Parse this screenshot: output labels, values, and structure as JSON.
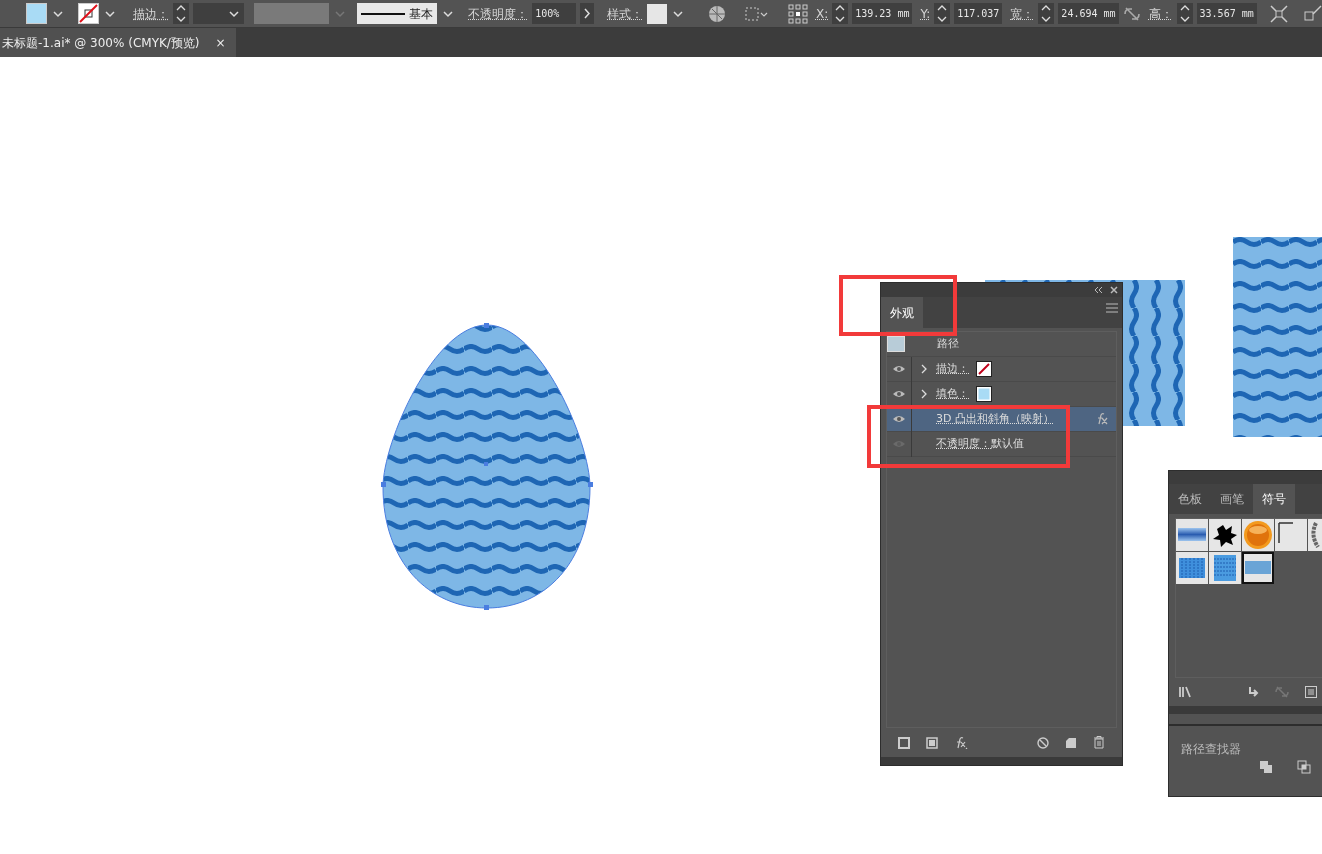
{
  "toolbar": {
    "stroke_label": "描边：",
    "brush_label": "基本",
    "opacity_label": "不透明度：",
    "opacity_value": "100%",
    "style_label": "样式：",
    "x_label": "X:",
    "x_value": "139.23 mm",
    "y_label": "Y:",
    "y_value": "117.037",
    "w_label": "宽：",
    "w_value": "24.694 mm",
    "h_label": "高：",
    "h_value": "33.567 mm"
  },
  "document_tab": {
    "title": "未标题-1.ai* @ 300% (CMYK/预览)",
    "close": "×"
  },
  "appearance_panel": {
    "tabs": [
      {
        "label": "外观",
        "selected": true
      }
    ],
    "items": [
      {
        "kind": "object",
        "label": "路径",
        "selected": false
      },
      {
        "kind": "stroke",
        "label": "描边：",
        "visible": true,
        "expandable": true,
        "selected": false
      },
      {
        "kind": "fill",
        "label": "填色：",
        "visible": true,
        "expandable": true,
        "selected": false
      },
      {
        "kind": "effect",
        "label": "3D 凸出和斜角（映射）",
        "visible": true,
        "expandable": false,
        "selected": true
      },
      {
        "kind": "opacity",
        "label": "不透明度：",
        "value": "默认值",
        "visible": false,
        "expandable": false,
        "selected": false
      }
    ]
  },
  "symbols_panel": {
    "tabs": [
      {
        "label": "色板",
        "selected": false
      },
      {
        "label": "画笔",
        "selected": false
      },
      {
        "label": "符号",
        "selected": true
      }
    ],
    "symbols": [
      {
        "kind": "gradient-bar",
        "selected": false
      },
      {
        "kind": "splat",
        "selected": false
      },
      {
        "kind": "orb",
        "selected": false
      },
      {
        "kind": "corner",
        "selected": false
      },
      {
        "kind": "wreath",
        "selected": false
      },
      {
        "kind": "wave-vertical",
        "selected": false
      },
      {
        "kind": "wave-horizontal",
        "selected": false
      },
      {
        "kind": "band",
        "selected": true
      }
    ]
  },
  "pathfinder_panel": {
    "title": "路径查找器"
  }
}
